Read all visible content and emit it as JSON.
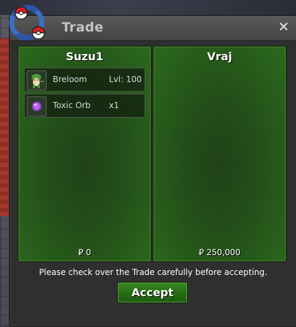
{
  "window": {
    "title": "Trade",
    "close_icon": "close-icon",
    "colors": {
      "panel_green": "#2b6a1d",
      "button_green": "#256b14",
      "title_text": "#c4c4c4"
    }
  },
  "left_panel": {
    "trader_name": "Suzu1",
    "items": [
      {
        "icon": "breloom-pokemon-icon",
        "name": "Breloom",
        "detail": "Lvl: 100"
      },
      {
        "icon": "toxic-orb-icon",
        "name": "Toxic Orb",
        "detail": "x1"
      }
    ],
    "money": "₽ 0"
  },
  "right_panel": {
    "trader_name": "Vraj",
    "items": [],
    "money": "₽ 250,000"
  },
  "notice": "Please check over the Trade carefully before accepting.",
  "accept_label": "Accept"
}
